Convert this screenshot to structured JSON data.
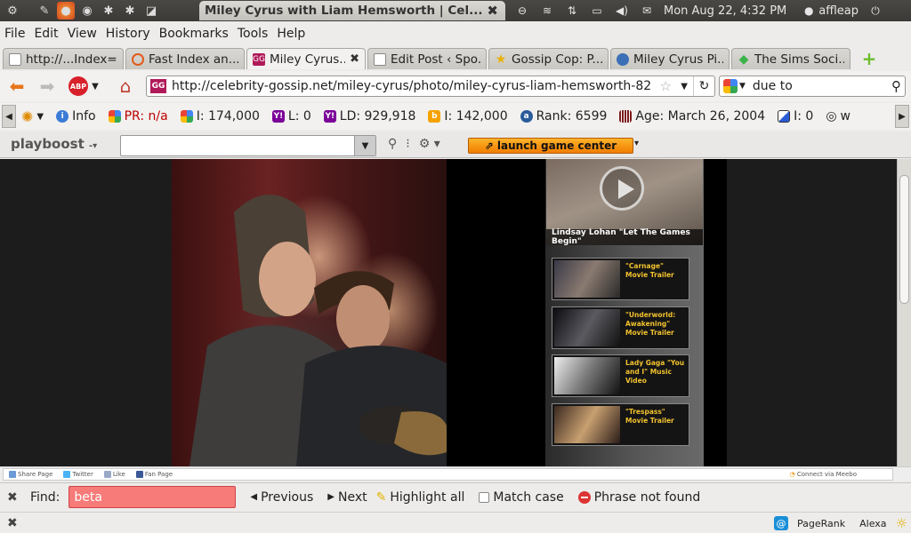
{
  "window_title": "Miley Cyrus with Liam Hemsworth | Cel...",
  "clock": "Mon Aug 22,  4:32 PM",
  "username": "affleap",
  "menu": [
    "File",
    "Edit",
    "View",
    "History",
    "Bookmarks",
    "Tools",
    "Help"
  ],
  "tabs": [
    {
      "label": "http://...Index=3",
      "favicon": "page-icon",
      "color": "#777777"
    },
    {
      "label": "Fast Index an...",
      "favicon": "loading-icon",
      "color": "#e25a1c"
    },
    {
      "label": "Miley Cyrus...",
      "favicon": "gg-icon",
      "color": "#b01a58",
      "active": true
    },
    {
      "label": "Edit Post ‹ Spo...",
      "favicon": "page-icon",
      "color": "#777777"
    },
    {
      "label": "Gossip Cop: P...",
      "favicon": "star-icon",
      "color": "#e8b100"
    },
    {
      "label": "Miley Cyrus Pi...",
      "favicon": "globe-icon",
      "color": "#3b6fb6"
    },
    {
      "label": "The Sims Soci...",
      "favicon": "sims-icon",
      "color": "#3bb34a"
    }
  ],
  "url": "http://celebrity-gossip.net/miley-cyrus/photo/miley-cyrus-liam-hemsworth-82",
  "search_query": "due to",
  "seo": {
    "info": "Info",
    "pr": "PR: n/a",
    "google_index": "I: 174,000",
    "yahoo_links": "L: 0",
    "yahoo_ld": "LD: 929,918",
    "bing_index": "I: 142,000",
    "alexa_rank": "Rank: 6599",
    "age": "Age: March 26, 2004",
    "delicious": "I: 0",
    "w": "w"
  },
  "playboost": {
    "logo": "playboost",
    "game_center": "launch game center"
  },
  "sidebar": {
    "main_caption": "Lindsay Lohan \"Let The Games Begin\"",
    "videos": [
      {
        "title": "\"Carnage\" Movie Trailer"
      },
      {
        "title": "\"Underworld: Awakening\" Movie Trailer"
      },
      {
        "title": "Lady Gaga \"You and I\" Music Video"
      },
      {
        "title": "\"Trespass\" Movie Trailer"
      }
    ]
  },
  "meebo": {
    "share": "Share Page",
    "twitter": "Twitter",
    "like": "Like",
    "fan": "Fan Page",
    "connect": "Connect via Meebo"
  },
  "find": {
    "label": "Find:",
    "value": "beta",
    "previous": "Previous",
    "next": "Next",
    "highlight": "Highlight all",
    "match_case": "Match case",
    "status": "Phrase not found"
  },
  "status_bar": {
    "pagerank": "PageRank",
    "alexa": "Alexa"
  }
}
